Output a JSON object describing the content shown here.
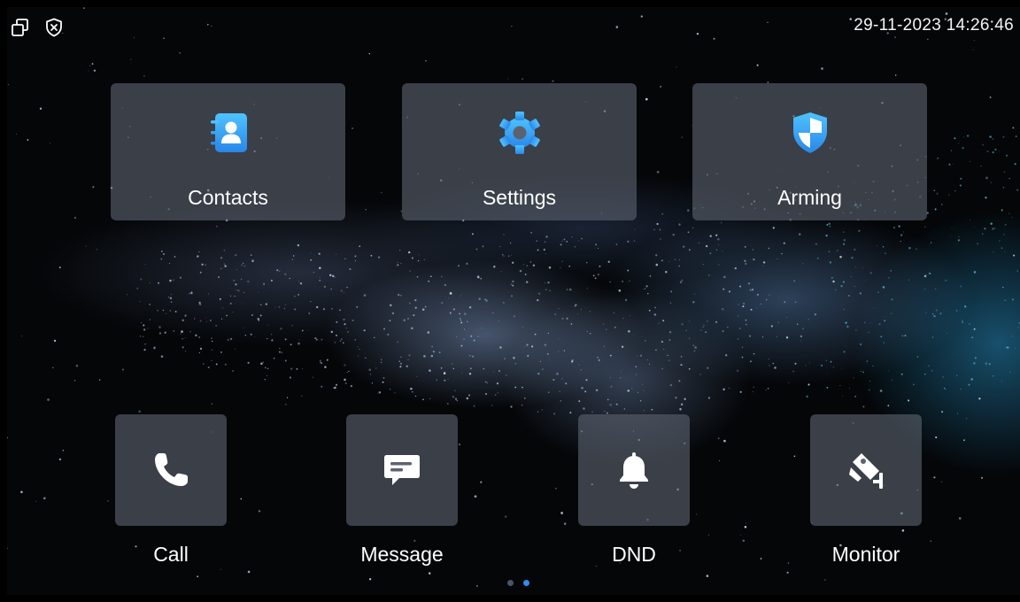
{
  "status_bar": {
    "datetime": "29-11-2023 14:26:46",
    "left_icons": [
      "window-restore-icon",
      "shield-x-icon"
    ]
  },
  "top_apps": [
    {
      "label": "Contacts",
      "icon": "contacts-icon"
    },
    {
      "label": "Settings",
      "icon": "settings-gear-icon"
    },
    {
      "label": "Arming",
      "icon": "shield-icon"
    }
  ],
  "bottom_apps": [
    {
      "label": "Call",
      "icon": "phone-icon"
    },
    {
      "label": "Message",
      "icon": "message-icon"
    },
    {
      "label": "DND",
      "icon": "bell-icon"
    },
    {
      "label": "Monitor",
      "icon": "camera-icon"
    }
  ],
  "pager": {
    "pages": 2,
    "active": 2
  },
  "colors": {
    "accent_blue": "#3fa9f5",
    "tile_bg": "#5c6270",
    "text": "#ffffff",
    "dot_inactive": "#4a5566",
    "dot_active": "#2f8cf0"
  }
}
